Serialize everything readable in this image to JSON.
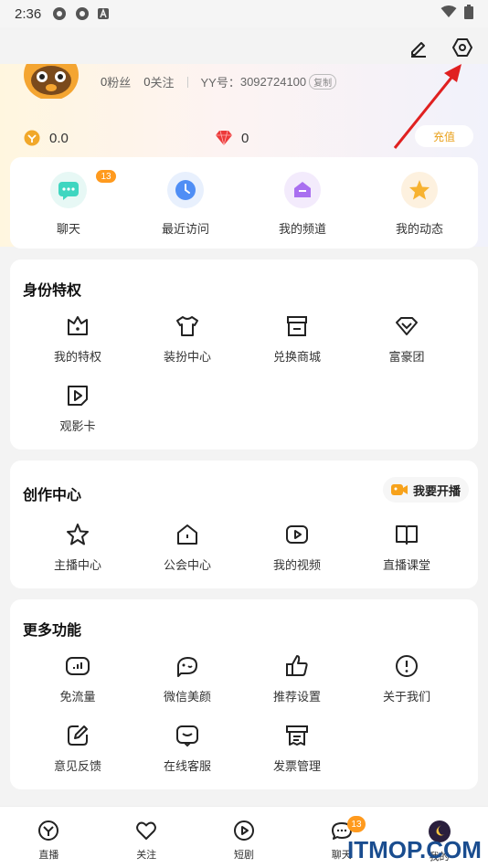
{
  "status_bar": {
    "time": "2:36"
  },
  "profile": {
    "fans_count": "0",
    "fans_label": "粉丝",
    "follow_count": "0",
    "follow_label": "关注",
    "yy_label": "YY号：",
    "yy_number": "3092724100",
    "copy_label": "复制"
  },
  "wallet": {
    "coins": "0.0",
    "diamonds": "0",
    "recharge_label": "充值"
  },
  "quick_actions": [
    {
      "label": "聊天",
      "icon": "chat-icon",
      "badge": "13"
    },
    {
      "label": "最近访问",
      "icon": "clock-icon"
    },
    {
      "label": "我的频道",
      "icon": "channel-icon"
    },
    {
      "label": "我的动态",
      "icon": "star-icon"
    }
  ],
  "identity_section": {
    "title": "身份特权",
    "items": [
      {
        "label": "我的特权",
        "icon": "crown-icon"
      },
      {
        "label": "装扮中心",
        "icon": "shirt-icon"
      },
      {
        "label": "兑换商城",
        "icon": "store-icon"
      },
      {
        "label": "富豪团",
        "icon": "diamond-icon"
      },
      {
        "label": "观影卡",
        "icon": "movie-card-icon"
      }
    ]
  },
  "creation_section": {
    "title": "创作中心",
    "live_button": "我要开播",
    "items": [
      {
        "label": "主播中心",
        "icon": "star-outline-icon"
      },
      {
        "label": "公会中心",
        "icon": "house-icon"
      },
      {
        "label": "我的视频",
        "icon": "video-icon"
      },
      {
        "label": "直播课堂",
        "icon": "book-icon"
      }
    ]
  },
  "more_section": {
    "title": "更多功能",
    "items": [
      {
        "label": "免流量",
        "icon": "traffic-icon"
      },
      {
        "label": "微信美颜",
        "icon": "beauty-icon"
      },
      {
        "label": "推荐设置",
        "icon": "thumbs-up-icon"
      },
      {
        "label": "关于我们",
        "icon": "info-icon"
      },
      {
        "label": "意见反馈",
        "icon": "feedback-icon"
      },
      {
        "label": "在线客服",
        "icon": "customer-service-icon"
      },
      {
        "label": "发票管理",
        "icon": "invoice-icon"
      }
    ]
  },
  "bottom_nav": [
    {
      "label": "直播",
      "icon": "live-icon"
    },
    {
      "label": "关注",
      "icon": "heart-icon"
    },
    {
      "label": "短剧",
      "icon": "play-icon"
    },
    {
      "label": "聊天",
      "icon": "chat-bubble-icon",
      "badge": "13"
    },
    {
      "label": "我的",
      "icon": "profile-avatar-icon"
    }
  ],
  "watermark": "ITMOP.COM",
  "colors": {
    "accent_orange": "#ff9a1e",
    "arrow_red": "#e02020"
  }
}
